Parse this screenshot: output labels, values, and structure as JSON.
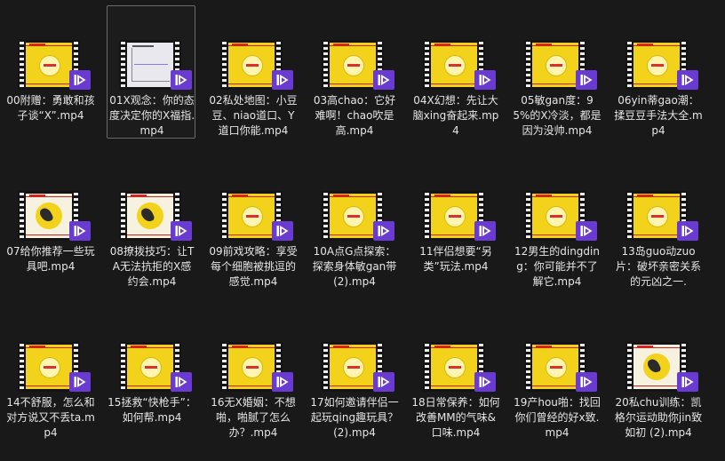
{
  "files": [
    {
      "name": "00附赠：勇敢和孩子谈“X”.mp4",
      "thumb": "yellow"
    },
    {
      "name": "01X观念：你的态度决定你的X福指.mp4",
      "thumb": "chart"
    },
    {
      "name": "02私处地图：小豆豆、niao道口、Y道口你能.mp4",
      "thumb": "yellow"
    },
    {
      "name": "03高chao：它好难啊！chao吹是高.mp4",
      "thumb": "yellow"
    },
    {
      "name": "04X幻想：先让大脑xing奋起来.mp4",
      "thumb": "yellow"
    },
    {
      "name": "05敏gan度：95%的X冷淡，都是因为没帅.mp4",
      "thumb": "yellow"
    },
    {
      "name": "06yin蒂gao潮：揉豆豆手法大全.mp4",
      "thumb": "yellow"
    },
    {
      "name": "07给你推荐一些玩具吧.mp4",
      "thumb": "photo"
    },
    {
      "name": "08撩拨技巧：让TA无法抗拒的X感约会.mp4",
      "thumb": "photo"
    },
    {
      "name": "09前戏攻略：享受每个细胞被挑逗的感觉.mp4",
      "thumb": "yellow"
    },
    {
      "name": "10A点G点探索：探索身体敏gan带 (2).mp4",
      "thumb": "yellow"
    },
    {
      "name": "11伴侣想要“另类”玩法.mp4",
      "thumb": "yellow"
    },
    {
      "name": "12男生的dingding：你可能并不了解它.mp4",
      "thumb": "yellow"
    },
    {
      "name": "13岛guo动zuo片：破坏亲密关系的元凶之一.",
      "thumb": "yellow"
    },
    {
      "name": "14不舒服，怎么和对方说又不丢ta.mp4",
      "thumb": "yellow"
    },
    {
      "name": "15拯救“快枪手”：如何帮.mp4",
      "thumb": "yellow"
    },
    {
      "name": "16无X婚姻：不想啪，啪腻了怎么办？.mp4",
      "thumb": "yellow"
    },
    {
      "name": "17如何邀请伴侣一起玩qing趣玩具？ (2).mp4",
      "thumb": "yellow"
    },
    {
      "name": "18日常保养：如何改善MM的气味&口味.mp4",
      "thumb": "yellow"
    },
    {
      "name": "19产hou啪：找回你们曾经的好x致.mp4",
      "thumb": "yellow"
    },
    {
      "name": "20私chu训练：凯格尔运动助你jin致如初 (2).mp4",
      "thumb": "photo"
    }
  ],
  "selected_index": 1,
  "icons": {
    "badge": "video-player-icon"
  },
  "colors": {
    "background": "#191919",
    "badge": "#6a3bd1",
    "thumbnail": "#f2d21b"
  }
}
